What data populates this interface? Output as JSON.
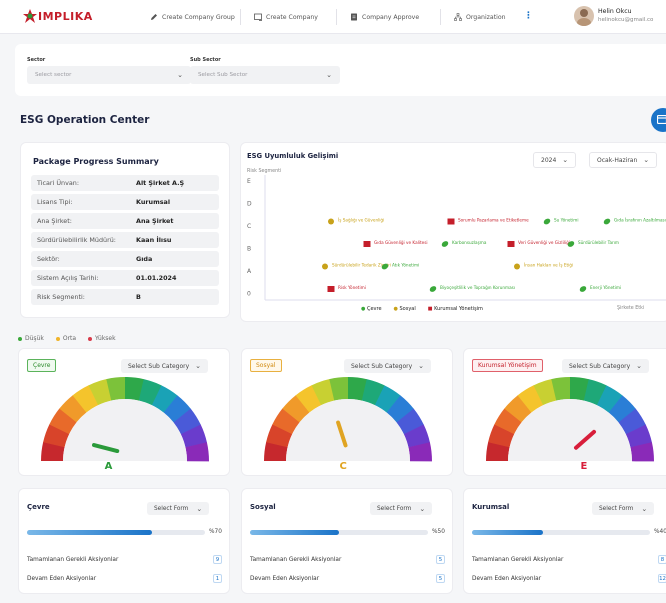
{
  "app": {
    "logo": "IMPLIKA"
  },
  "nav": [
    {
      "label": "Create Company Group",
      "icon": "pencil-icon"
    },
    {
      "label": "Create Company",
      "icon": "company-add-icon"
    },
    {
      "label": "Company Approve",
      "icon": "approve-doc-icon"
    },
    {
      "label": "Organization",
      "icon": "org-chart-icon"
    }
  ],
  "user": {
    "name": "Helin Okcu",
    "email": "helinokcu@gmail.co"
  },
  "filters": {
    "sector_label": "Sector",
    "sector_placeholder": "Select sector",
    "subsector_label": "Sub Sector",
    "subsector_placeholder": "Select Sub Sector"
  },
  "page_title": "ESG Operation Center",
  "summary": {
    "title": "Package Progress Summary",
    "rows": [
      {
        "key": "Ticari Ünvan:",
        "value": "Alt Şirket A.Ş"
      },
      {
        "key": "Lisans Tipi:",
        "value": "Kurumsal"
      },
      {
        "key": "Ana Şirket:",
        "value": "Ana Şirket"
      },
      {
        "key": "Sürdürülebilirlik Müdürü:",
        "value": "Kaan İlısu"
      },
      {
        "key": "Sektör:",
        "value": "Gıda"
      },
      {
        "key": "Sistem Açılış Tarihi:",
        "value": "01.01.2024"
      },
      {
        "key": "Risk Segmenti:",
        "value": "B"
      }
    ]
  },
  "esg_chart": {
    "title": "ESG Uyumluluk Gelişimi",
    "year": "2024",
    "period": "Ocak-Haziran",
    "y_axis_title": "Risk Segmenti",
    "x_axis_title": "Şirkete Etki",
    "legend": [
      {
        "label": "Çevre",
        "color": "#3aa83a",
        "icon": "leaf-icon"
      },
      {
        "label": "Sosyal",
        "color": "#c8a21a",
        "icon": "people-icon"
      },
      {
        "label": "Kurumsal Yönetişim",
        "color": "#c41e2a",
        "icon": "bank-icon"
      }
    ]
  },
  "chart_data": {
    "type": "scatter",
    "title": "ESG Uyumluluk Gelişimi",
    "ylabel": "Risk Segmenti",
    "xlabel": "Şirkete Etki",
    "y_categories": [
      "E",
      "D",
      "C",
      "B",
      "A",
      "0"
    ],
    "points": [
      {
        "label": "İş Sağlığı ve Güvenliği",
        "category": "Sosyal",
        "x": 1,
        "y": "D"
      },
      {
        "label": "Sorumlu Pazarlama ve Etiketleme",
        "category": "Kurumsal Yönetişim",
        "x": 3,
        "y": "D"
      },
      {
        "label": "Su Yönetimi",
        "category": "Çevre",
        "x": 4.6,
        "y": "D"
      },
      {
        "label": "Gıda İsrafının Azaltılması",
        "category": "Çevre",
        "x": 5.6,
        "y": "D"
      },
      {
        "label": "Gıda Güvenliği ve Kalitesi",
        "category": "Kurumsal Yönetişim",
        "x": 1.6,
        "y": "C"
      },
      {
        "label": "Karbonsuzlaşma",
        "category": "Çevre",
        "x": 2.9,
        "y": "C"
      },
      {
        "label": "Veri Güvenliği ve Gizliliği",
        "category": "Kurumsal Yönetişim",
        "x": 4,
        "y": "C"
      },
      {
        "label": "Sürdürülebilir Tarım",
        "category": "Çevre",
        "x": 5,
        "y": "C"
      },
      {
        "label": "Sürdürülebilir Tedarik Zinciri",
        "category": "Sosyal",
        "x": 0.9,
        "y": "B"
      },
      {
        "label": "Atık Yönetimi",
        "category": "Çevre",
        "x": 1.9,
        "y": "B"
      },
      {
        "label": "İnsan Hakları ve İş Etiği",
        "category": "Sosyal",
        "x": 4.1,
        "y": "B"
      },
      {
        "label": "Risk Yönetimi",
        "category": "Kurumsal Yönetişim",
        "x": 1,
        "y": "A"
      },
      {
        "label": "Biyoçeşitlilik ve Toprağın Korunması",
        "category": "Çevre",
        "x": 2.7,
        "y": "A"
      },
      {
        "label": "Enerji Yönetimi",
        "category": "Çevre",
        "x": 5.2,
        "y": "A"
      }
    ]
  },
  "risk_legend": [
    {
      "label": "Düşük",
      "color": "#3aa83a"
    },
    {
      "label": "Orta",
      "color": "#f0b42a"
    },
    {
      "label": "Yüksek",
      "color": "#d83a4a"
    }
  ],
  "gauges": [
    {
      "tag": "Çevre",
      "select": "Select Sub Category",
      "grade": "A",
      "value": 0.08,
      "color": "#2a9a3a"
    },
    {
      "tag": "Sosyal",
      "select": "Select Sub Category",
      "grade": "C",
      "value": 0.4,
      "color": "#e0a422"
    },
    {
      "tag": "Kurumsal Yönetişim",
      "select": "Select Sub Category",
      "grade": "E",
      "value": 0.77,
      "color": "#d81e3a"
    }
  ],
  "progress_cards": [
    {
      "title": "Çevre",
      "select": "Select Form",
      "percent": "%70",
      "value": 0.7,
      "stat1_label": "Tamamlanan Gerekli Aksiyonlar",
      "stat1": "9",
      "stat2_label": "Devam Eden Aksiyonlar",
      "stat2": "1"
    },
    {
      "title": "Sosyal",
      "select": "Select Form",
      "percent": "%50",
      "value": 0.5,
      "stat1_label": "Tamamlanan Gerekli Aksiyonlar",
      "stat1": "5",
      "stat2_label": "Devam Eden Aksiyonlar",
      "stat2": "5"
    },
    {
      "title": "Kurumsal",
      "select": "Select Form",
      "percent": "%40",
      "value": 0.4,
      "stat1_label": "Tamamlanan Gerekli Aksiyonlar",
      "stat1": "8",
      "stat2_label": "Devam Eden Aksiyonlar",
      "stat2": "12"
    }
  ]
}
